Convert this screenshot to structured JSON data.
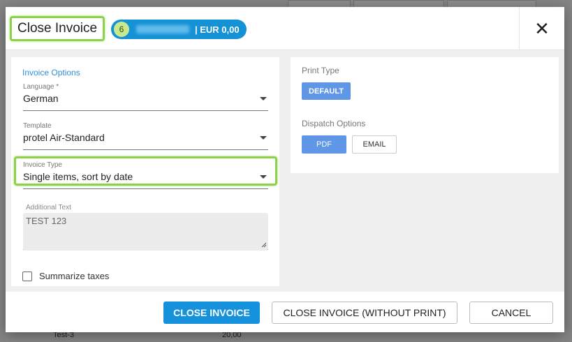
{
  "dialog": {
    "title": "Close Invoice",
    "guest_pill": {
      "count": "6",
      "amount": "| EUR 0,00"
    },
    "close_symbol": "✕"
  },
  "invoice_options": {
    "section_title": "Invoice Options",
    "language": {
      "label": "Language *",
      "value": "German"
    },
    "template": {
      "label": "Template",
      "value": "protel Air-Standard"
    },
    "invoice_type": {
      "label": "Invoice Type",
      "value": "Single items, sort by date"
    },
    "additional_text": {
      "label": "Additional Text",
      "value": "TEST 123"
    },
    "summarize_taxes": {
      "label": "Summarize taxes",
      "checked": false
    }
  },
  "print_options": {
    "print_type_label": "Print Type",
    "print_type_button": "DEFAULT",
    "dispatch_label": "Dispatch Options",
    "dispatch_buttons": [
      "PDF",
      "EMAIL"
    ]
  },
  "footer": {
    "close_invoice": "CLOSE INVOICE",
    "close_without_print": "CLOSE INVOICE (WITHOUT PRINT)",
    "cancel": "CANCEL"
  },
  "background": {
    "row_name": "Test-3",
    "row_amount": "20,00"
  },
  "colors": {
    "accent_blue": "#1592db",
    "highlight_green": "#8bd14a",
    "toggle_blue": "#5f96e5",
    "section_title": "#2f8fd8"
  }
}
